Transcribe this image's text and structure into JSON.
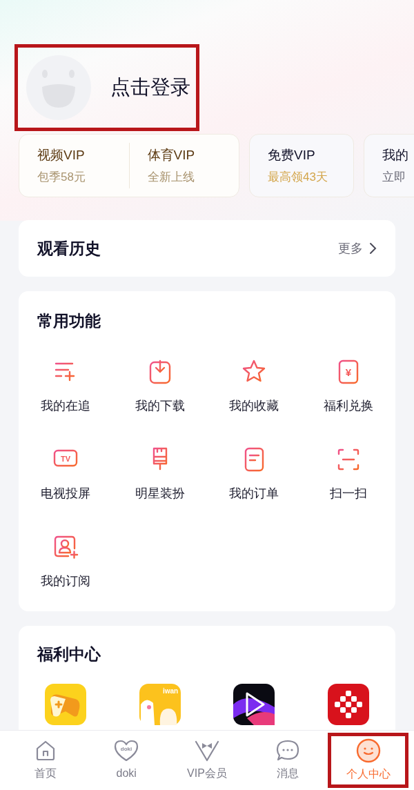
{
  "profile": {
    "login_label": "点击登录",
    "highlighted": true
  },
  "vip_cards": [
    {
      "sections": [
        {
          "title": "视频VIP",
          "subtitle": "包季58元"
        },
        {
          "title": "体育VIP",
          "subtitle": "全新上线"
        }
      ],
      "kind": "gold"
    },
    {
      "sections": [
        {
          "title": "免费VIP",
          "subtitle": "最高领43天"
        }
      ],
      "kind": "plain"
    },
    {
      "sections": [
        {
          "title": "我的",
          "subtitle": "立即"
        }
      ],
      "kind": "plain"
    }
  ],
  "history": {
    "title": "观看历史",
    "more": "更多"
  },
  "functions": {
    "title": "常用功能",
    "items": [
      {
        "label": "我的在追"
      },
      {
        "label": "我的下载"
      },
      {
        "label": "我的收藏"
      },
      {
        "label": "福利兑换",
        "icon_text": "¥"
      },
      {
        "label": "电视投屏",
        "icon_text": "TV"
      },
      {
        "label": "明星装扮"
      },
      {
        "label": "我的订单"
      },
      {
        "label": "扫一扫"
      },
      {
        "label": "我的订阅"
      }
    ]
  },
  "welfare": {
    "title": "福利中心",
    "apps": [
      {
        "kind": "game"
      },
      {
        "kind": "iwan",
        "icon_text": "iwan"
      },
      {
        "kind": "video"
      },
      {
        "kind": "red"
      }
    ]
  },
  "tabs": [
    {
      "label": "首页",
      "selected": false,
      "highlighted": false
    },
    {
      "label": "doki",
      "selected": false,
      "highlighted": false,
      "icon_text": "doki"
    },
    {
      "label": "VIP会员",
      "selected": false,
      "highlighted": false
    },
    {
      "label": "消息",
      "selected": false,
      "highlighted": false
    },
    {
      "label": "个人中心",
      "selected": true,
      "highlighted": true
    }
  ]
}
